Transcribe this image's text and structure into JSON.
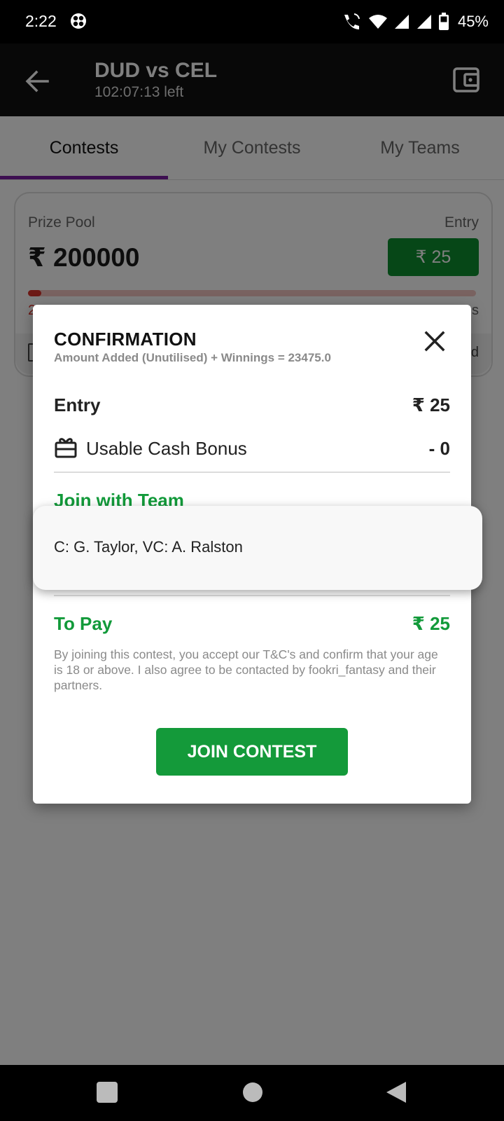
{
  "status_bar": {
    "time": "2:22",
    "battery": "45%"
  },
  "app_bar": {
    "title": "DUD vs CEL",
    "time_left": "102:07:13 left"
  },
  "tabs": [
    {
      "label": "Contests",
      "active": true
    },
    {
      "label": "My Contests",
      "active": false
    },
    {
      "label": "My Teams",
      "active": false
    }
  ],
  "contest_card": {
    "prize_pool_label": "Prize Pool",
    "prize_pool_value": "₹ 200000",
    "entry_label": "Entry",
    "entry_fee": "₹ 25",
    "left_fragment": "2",
    "right_fragment": "s",
    "footer_right_fragment": "d",
    "fill_fraction": 0.03
  },
  "dialog": {
    "title": "CONFIRMATION",
    "subtitle": "Amount Added (Unutilised) + Winnings = 23475.0",
    "entry_label": "Entry",
    "entry_value": "₹ 25",
    "bonus_label": "Usable Cash Bonus",
    "bonus_value": "- 0",
    "join_team_label": "Join with Team",
    "to_pay_label": "To Pay",
    "to_pay_value": "₹ 25",
    "terms": "By joining this contest, you accept our T&C's and confirm that your age is 18 or above. I also agree to be contacted by fookri_fantasy and their partners.",
    "join_button": "JOIN CONTEST"
  },
  "team_dropdown": {
    "option": "C: G. Taylor, VC: A. Ralston"
  },
  "colors": {
    "accent_green": "#149a3a",
    "tab_indicator": "#7b1fa2",
    "progress": "#d9332a"
  }
}
